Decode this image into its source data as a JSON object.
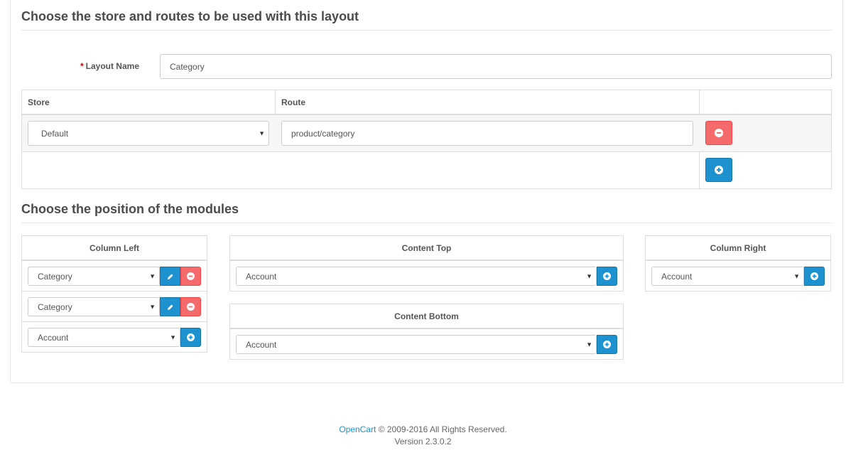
{
  "sections": {
    "store_routes_title": "Choose the store and routes to be used with this layout",
    "modules_title": "Choose the position of the modules"
  },
  "layout_name": {
    "required_mark": "*",
    "label": "Layout Name",
    "value": "Category"
  },
  "route_table": {
    "headers": [
      "Store",
      "Route",
      ""
    ],
    "rows": [
      {
        "store": "Default",
        "route": "product/category"
      }
    ]
  },
  "positions": {
    "column_left": {
      "title": "Column Left",
      "modules": [
        "Category",
        "Category"
      ],
      "add_select": "Account"
    },
    "content_top": {
      "title": "Content Top",
      "add_select": "Account"
    },
    "content_bottom": {
      "title": "Content Bottom",
      "add_select": "Account"
    },
    "column_right": {
      "title": "Column Right",
      "add_select": "Account"
    }
  },
  "footer": {
    "brand": "OpenCart",
    "copyright": "© 2009-2016 All Rights Reserved.",
    "version": "Version 2.3.0.2"
  },
  "colors": {
    "primary": "#1e91cf",
    "danger": "#f56b6b",
    "required": "#cc0000"
  },
  "icons": {
    "remove": "minus-circle-icon",
    "add": "plus-circle-icon",
    "edit": "pencil-icon",
    "dropdown": "caret-down-icon"
  }
}
